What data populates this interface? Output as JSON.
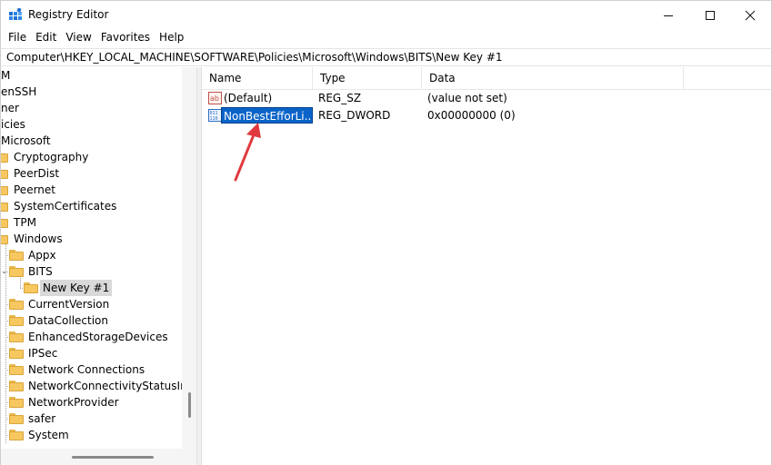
{
  "window": {
    "title": "Registry Editor",
    "accent": "#0a64c8",
    "controls": {
      "minimize": "minimize-icon",
      "maximize": "maximize-icon",
      "close": "close-icon"
    }
  },
  "menu": [
    "File",
    "Edit",
    "View",
    "Favorites",
    "Help"
  ],
  "address": "Computer\\HKEY_LOCAL_MACHINE\\SOFTWARE\\Policies\\Microsoft\\Windows\\BITS\\New Key #1",
  "tree": {
    "items": [
      {
        "label": "M"
      },
      {
        "label": "enSSH"
      },
      {
        "label": "ner"
      },
      {
        "label": "icies"
      },
      {
        "label": "Microsoft"
      },
      {
        "label": "Cryptography"
      },
      {
        "label": "PeerDist"
      },
      {
        "label": "Peernet"
      },
      {
        "label": "SystemCertificates"
      },
      {
        "label": "TPM"
      },
      {
        "label": "Windows"
      },
      {
        "label": "Appx"
      },
      {
        "label": "BITS"
      },
      {
        "label": "New Key #1"
      },
      {
        "label": "CurrentVersion"
      },
      {
        "label": "DataCollection"
      },
      {
        "label": "EnhancedStorageDevices"
      },
      {
        "label": "IPSec"
      },
      {
        "label": "Network Connections"
      },
      {
        "label": "NetworkConnectivityStatusIndic"
      },
      {
        "label": "NetworkProvider"
      },
      {
        "label": "safer"
      },
      {
        "label": "System"
      }
    ],
    "selected": "New Key #1"
  },
  "list": {
    "columns": [
      "Name",
      "Type",
      "Data"
    ],
    "rows": [
      {
        "name": "(Default)",
        "type": "REG_SZ",
        "data": "(value not set)",
        "icon": "string-value-icon"
      },
      {
        "name": "NonBestEfforLi...",
        "type": "REG_DWORD",
        "data": "0x00000000 (0)",
        "icon": "dword-value-icon",
        "editing": true
      }
    ]
  },
  "annotation": {
    "color": "#e0393e"
  }
}
